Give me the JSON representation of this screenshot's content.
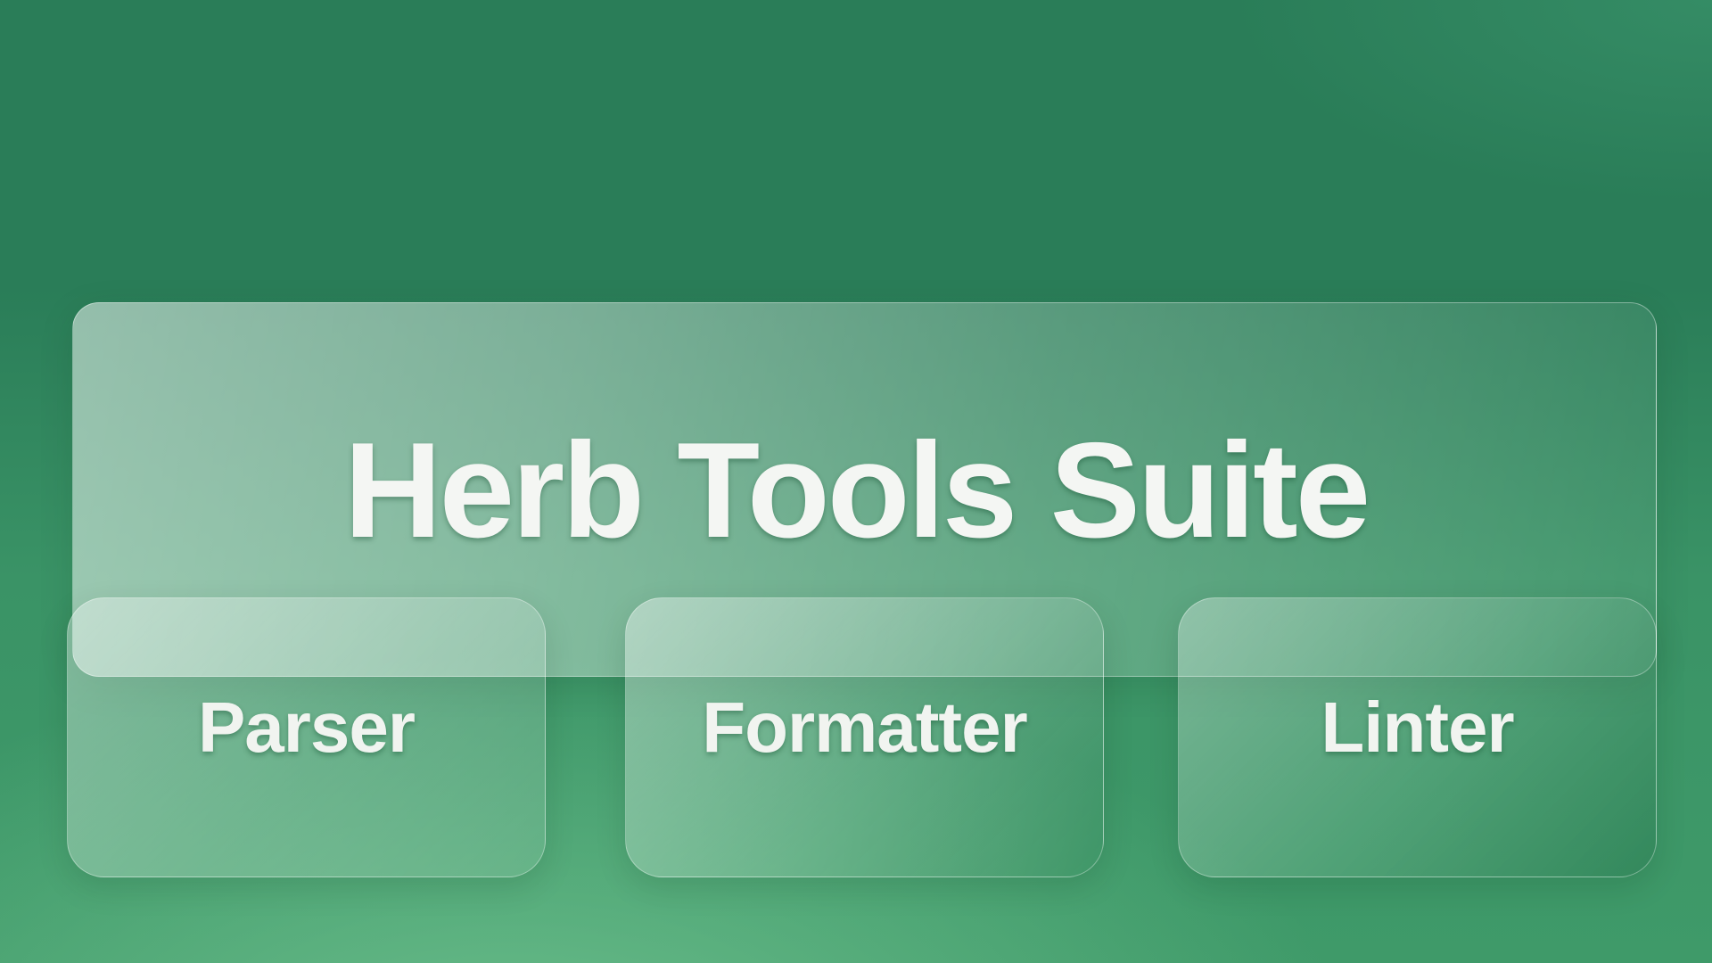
{
  "hero": {
    "title": "Herb Tools Suite"
  },
  "tools": [
    {
      "label": "Parser"
    },
    {
      "label": "Formatter"
    },
    {
      "label": "Linter"
    }
  ]
}
